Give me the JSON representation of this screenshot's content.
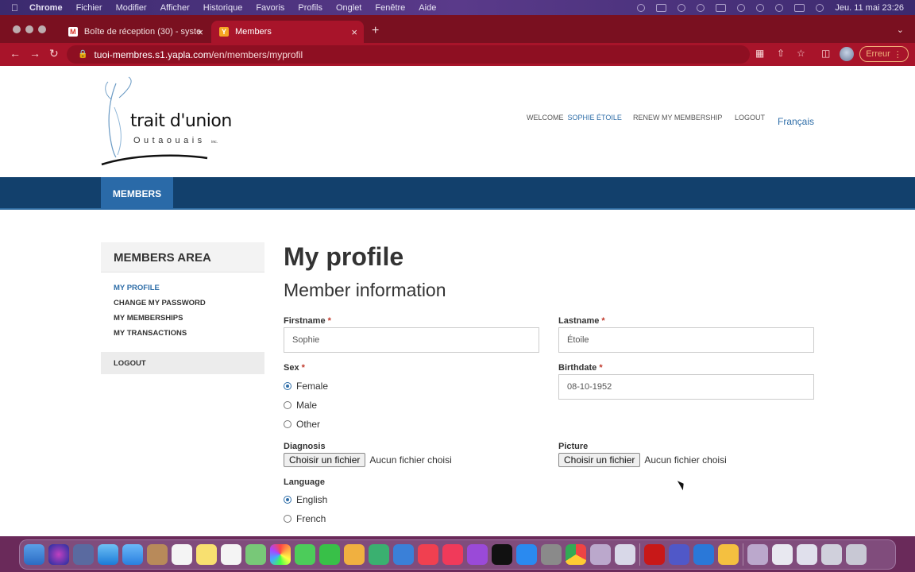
{
  "menubar": {
    "app": "Chrome",
    "items": [
      "Fichier",
      "Modifier",
      "Afficher",
      "Historique",
      "Favoris",
      "Profils",
      "Onglet",
      "Fenêtre",
      "Aide"
    ],
    "clock": "Jeu. 11 mai  23:26"
  },
  "browser": {
    "tabs": [
      {
        "title": "Boîte de réception (30) - syste",
        "favicon": "M"
      },
      {
        "title": "Members",
        "favicon": "Y"
      }
    ],
    "url_host": "tuoi-membres.s1.yapla.com",
    "url_path": "/en/members/myprofil",
    "error_label": "Erreur",
    "new_tab": "+",
    "close": "×"
  },
  "site": {
    "logo_word": "trait d'union",
    "logo_sub": "Outaouais",
    "logo_inc": "inc.",
    "welcome": "WELCOME",
    "user_name": "SOPHIE ÉTOILE",
    "renew": "RENEW MY MEMBERSHIP",
    "logout": "LOGOUT",
    "language_switch": "Français",
    "nav_members": "MEMBERS"
  },
  "sidebar": {
    "title": "MEMBERS AREA",
    "items": [
      "MY PROFILE",
      "CHANGE MY PASSWORD",
      "MY MEMBERSHIPS",
      "MY TRANSACTIONS"
    ],
    "logout": "LOGOUT"
  },
  "form": {
    "title": "My profile",
    "subtitle": "Member information",
    "required_mark": "*",
    "firstname_label": "Firstname",
    "firstname_value": "Sophie",
    "lastname_label": "Lastname",
    "lastname_value": "Étoile",
    "sex_label": "Sex",
    "sex_options": [
      "Female",
      "Male",
      "Other"
    ],
    "sex_selected": "Female",
    "birthdate_label": "Birthdate",
    "birthdate_value": "08-10-1952",
    "diagnosis_label": "Diagnosis",
    "picture_label": "Picture",
    "file_button": "Choisir un fichier",
    "file_none": "Aucun fichier choisi",
    "language_label": "Language",
    "language_options": [
      "English",
      "French"
    ],
    "language_selected": "English"
  },
  "colors": {
    "browser_frame": "#a8142a",
    "site_nav": "#12406c",
    "link_blue": "#2f6ea8"
  }
}
